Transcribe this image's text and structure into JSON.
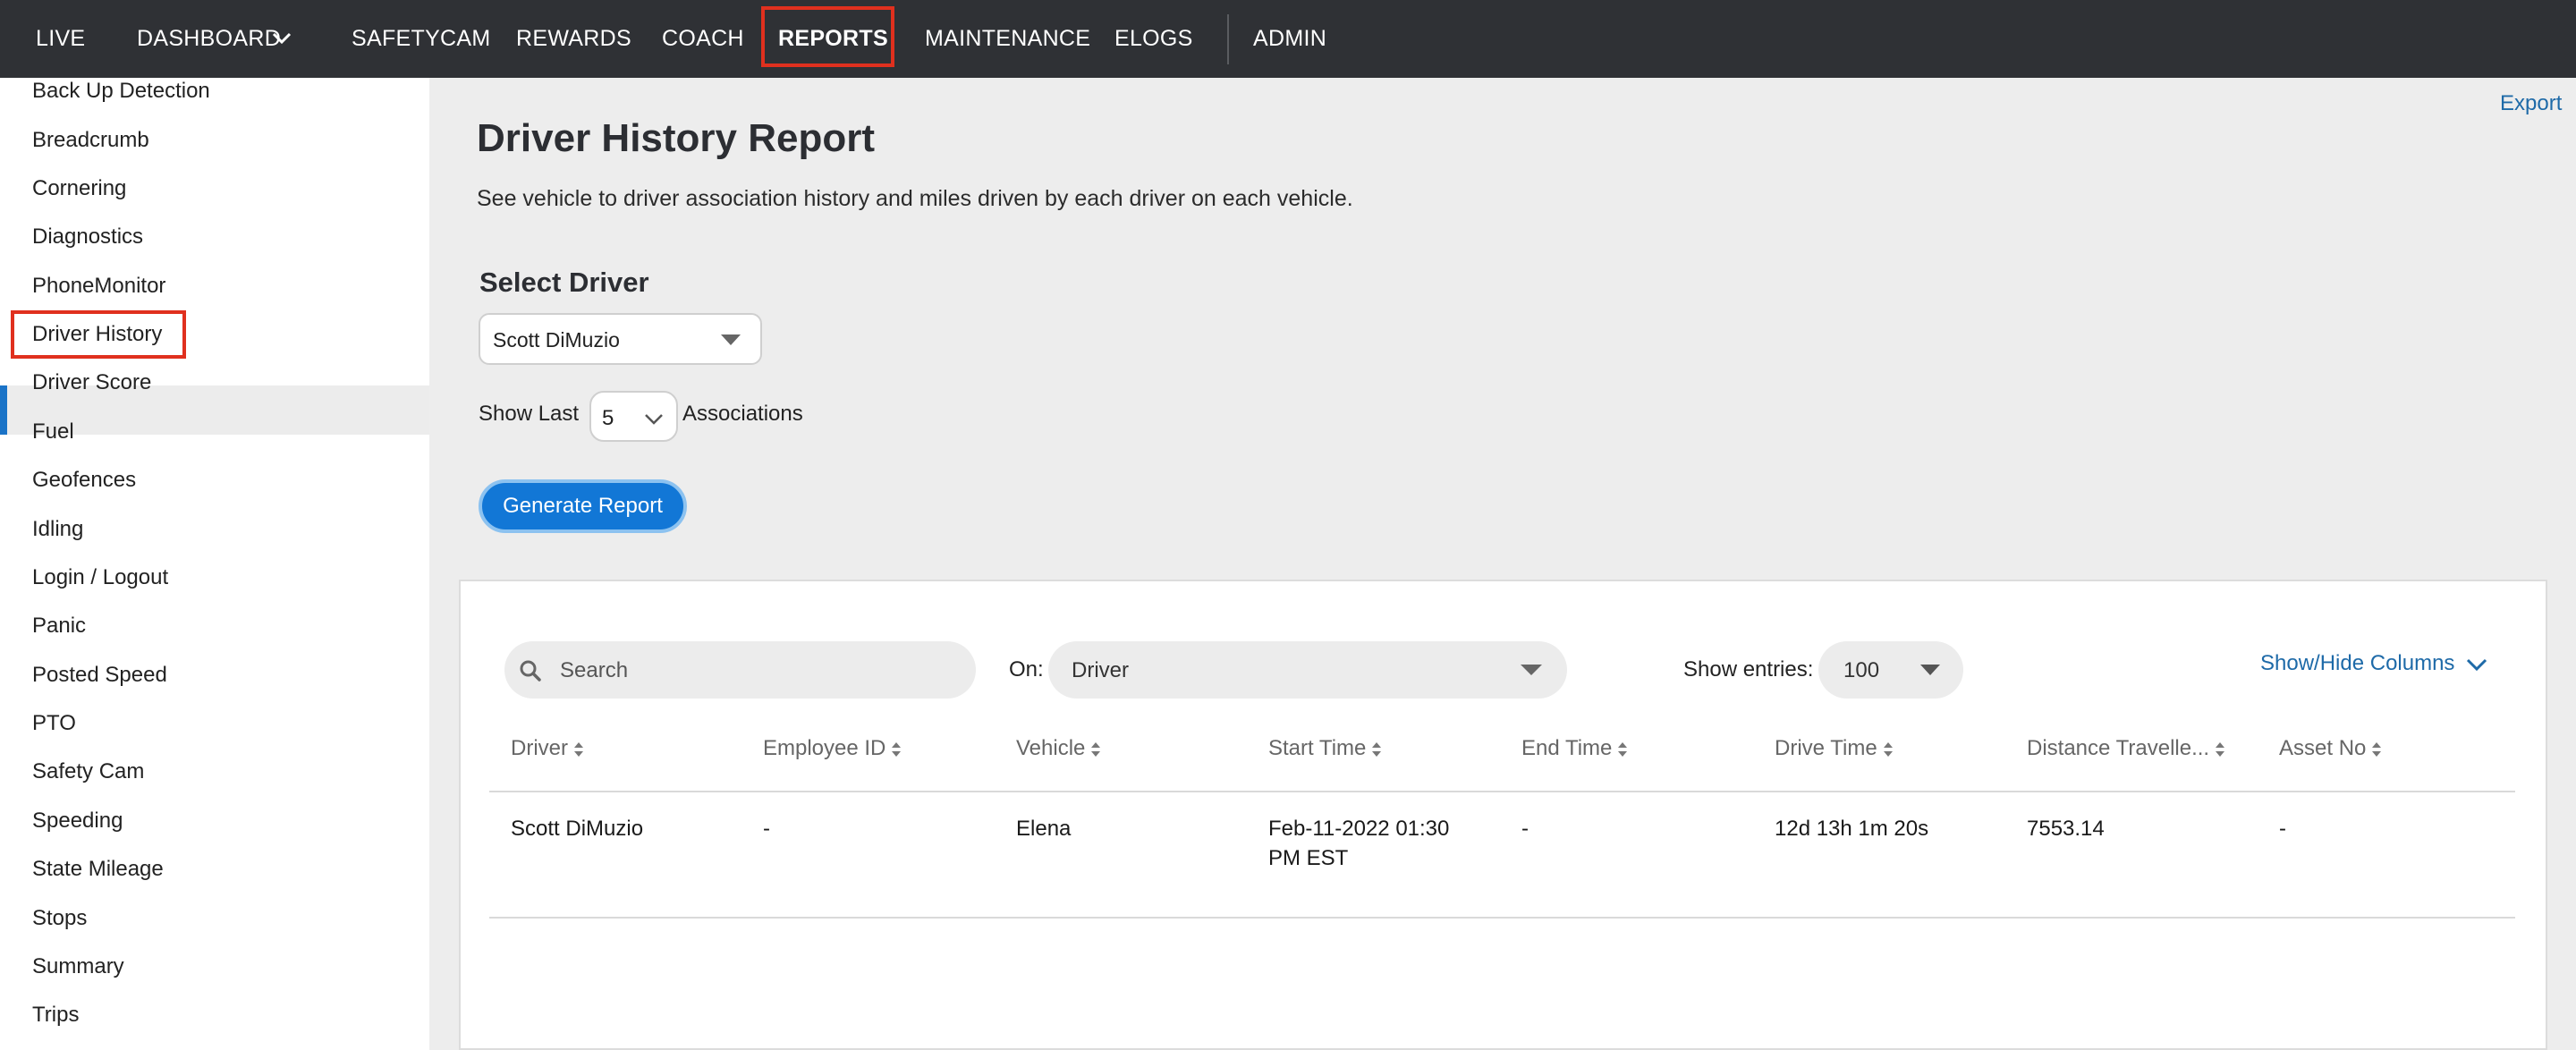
{
  "nav": {
    "items": [
      {
        "label": "LIVE"
      },
      {
        "label": "DASHBOARD"
      },
      {
        "label": "SAFETYCAM"
      },
      {
        "label": "REWARDS"
      },
      {
        "label": "COACH"
      },
      {
        "label": "REPORTS"
      },
      {
        "label": "MAINTENANCE"
      },
      {
        "label": "ELOGS"
      },
      {
        "label": "ADMIN"
      }
    ],
    "active": "REPORTS"
  },
  "sidebar": {
    "items": [
      {
        "label": "Back Up Detection"
      },
      {
        "label": "Breadcrumb"
      },
      {
        "label": "Cornering"
      },
      {
        "label": "Diagnostics"
      },
      {
        "label": "PhoneMonitor"
      },
      {
        "label": "Driver History"
      },
      {
        "label": "Driver Score"
      },
      {
        "label": "Fuel"
      },
      {
        "label": "Geofences"
      },
      {
        "label": "Idling"
      },
      {
        "label": "Login / Logout"
      },
      {
        "label": "Panic"
      },
      {
        "label": "Posted Speed"
      },
      {
        "label": "PTO"
      },
      {
        "label": "Safety Cam"
      },
      {
        "label": "Speeding"
      },
      {
        "label": "State Mileage"
      },
      {
        "label": "Stops"
      },
      {
        "label": "Summary"
      },
      {
        "label": "Trips"
      }
    ],
    "active": "Driver History"
  },
  "header": {
    "export": "Export",
    "title": "Driver History Report",
    "subtitle": "See vehicle to driver association history and miles driven by each driver on each vehicle."
  },
  "form": {
    "select_driver_label": "Select Driver",
    "driver_value": "Scott DiMuzio",
    "show_last_label": "Show Last",
    "show_last_value": "5",
    "associations_label": "Associations",
    "generate_button": "Generate Report"
  },
  "table_controls": {
    "search_placeholder": "Search",
    "on_label": "On:",
    "on_value": "Driver",
    "entries_label": "Show entries:",
    "entries_value": "100",
    "show_hide_columns": "Show/Hide Columns"
  },
  "table": {
    "columns": [
      "Driver",
      "Employee ID",
      "Vehicle",
      "Start Time",
      "End Time",
      "Drive Time",
      "Distance Travelle...",
      "Asset No"
    ],
    "rows": [
      {
        "driver": "Scott DiMuzio",
        "employee_id": "-",
        "vehicle": "Elena",
        "start_time_line1": "Feb-11-2022 01:30",
        "start_time_line2": "PM EST",
        "end_time": "-",
        "drive_time": "12d 13h 1m 20s",
        "distance": "7553.14",
        "asset_no": "-"
      }
    ]
  },
  "colors": {
    "nav_bg": "#2f3135",
    "accent_blue": "#1277d6",
    "link_blue": "#1e6aa8",
    "highlight_red": "#e0301e"
  }
}
